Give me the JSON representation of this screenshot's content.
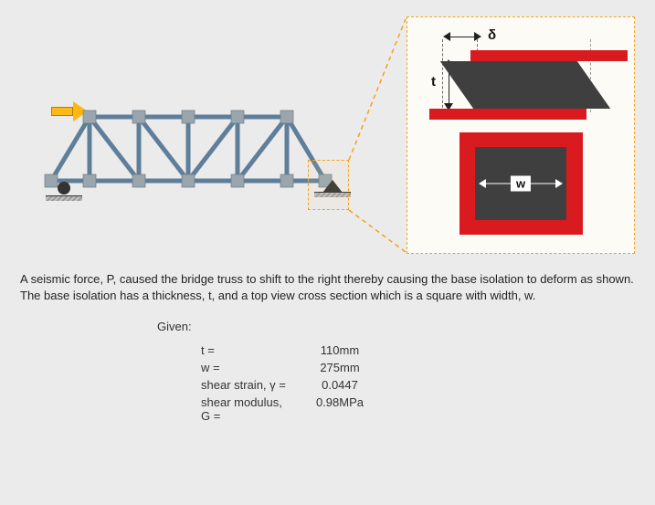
{
  "problem": {
    "description": "A seismic force, P, caused the bridge truss to shift to the right thereby causing the base isolation to deform as shown. The base isolation has a thickness, t, and a top view cross section which is a square with width, w."
  },
  "diagram": {
    "delta_symbol": "δ",
    "t_symbol": "t",
    "w_symbol": "w"
  },
  "given": {
    "heading": "Given:",
    "rows": [
      {
        "param": "t =",
        "value": "110mm"
      },
      {
        "param": "w =",
        "value": "275mm"
      },
      {
        "param": "shear strain, γ =",
        "value": "0.0447"
      },
      {
        "param": "shear modulus, G =",
        "value": "0.98MPa"
      }
    ]
  },
  "chart_data": {
    "type": "table",
    "title": "Given parameters",
    "rows": [
      {
        "parameter": "t",
        "value": 110,
        "unit": "mm"
      },
      {
        "parameter": "w",
        "value": 275,
        "unit": "mm"
      },
      {
        "parameter": "shear strain γ",
        "value": 0.0447,
        "unit": ""
      },
      {
        "parameter": "shear modulus G",
        "value": 0.98,
        "unit": "MPa"
      }
    ]
  }
}
